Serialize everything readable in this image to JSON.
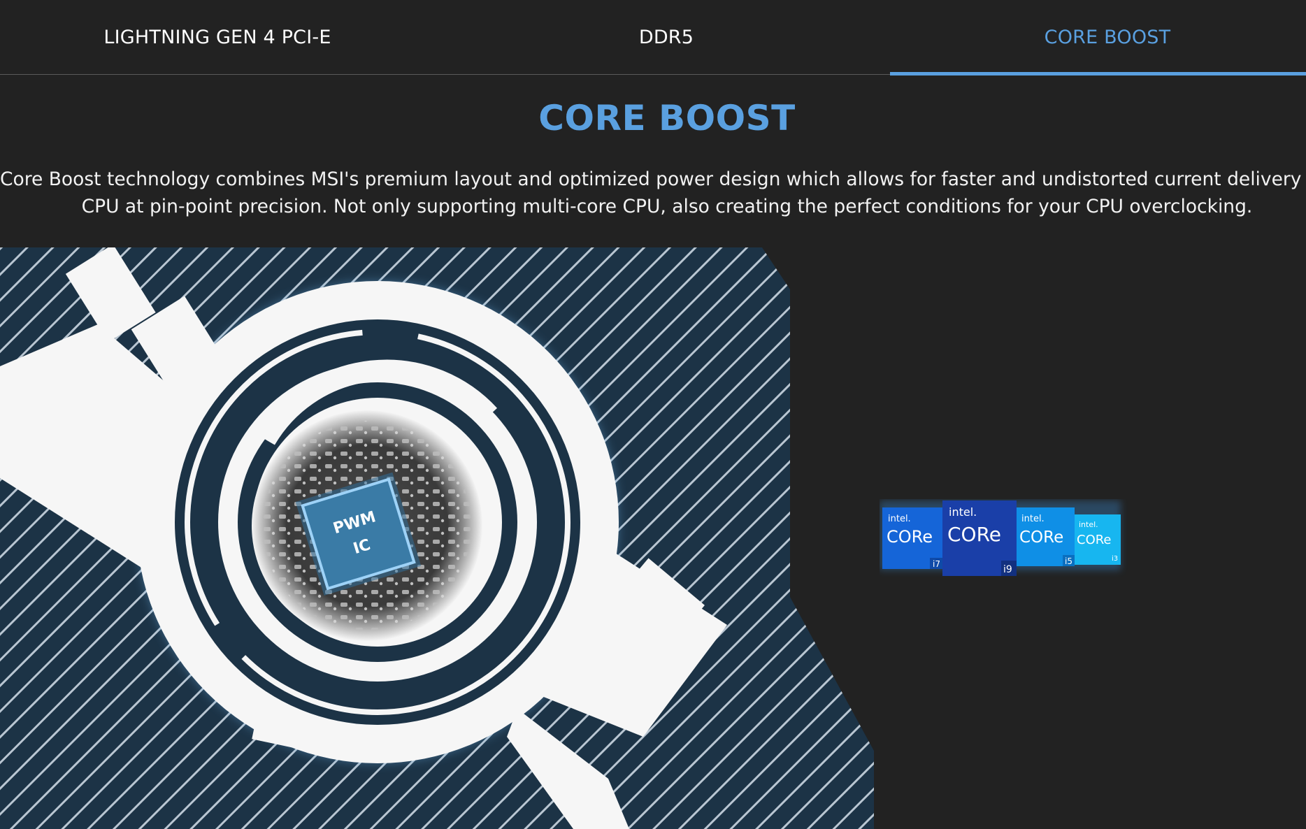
{
  "tabs": [
    {
      "label": "LIGHTNING GEN 4 PCI-E",
      "active": false
    },
    {
      "label": "DDR5",
      "active": false
    },
    {
      "label": "CORE BOOST",
      "active": true
    }
  ],
  "section": {
    "title": "CORE BOOST",
    "description_line1": "Core Boost technology combines MSI's premium layout and optimized power design which allows for faster and undistorted current delivery to the",
    "description_line2": "CPU at pin-point precision. Not only supporting multi-core CPU, also creating the perfect conditions for your CPU overclocking."
  },
  "chip": {
    "line1": "PWM",
    "line2": "IC"
  },
  "intel_badges": [
    {
      "brand": "intel.",
      "name": "CORe",
      "tier": "i7"
    },
    {
      "brand": "intel.",
      "name": "CORe",
      "tier": "i9"
    },
    {
      "brand": "intel.",
      "name": "CORe",
      "tier": "i5"
    },
    {
      "brand": "intel.",
      "name": "CORe",
      "tier": "i3"
    }
  ],
  "colors": {
    "background": "#222222",
    "accent": "#5aa0e0",
    "art_navy": "#1c3346",
    "i7": "#1565d8",
    "i9": "#1a3fa8",
    "i5": "#0f8fe6",
    "i3": "#17b6f0"
  }
}
